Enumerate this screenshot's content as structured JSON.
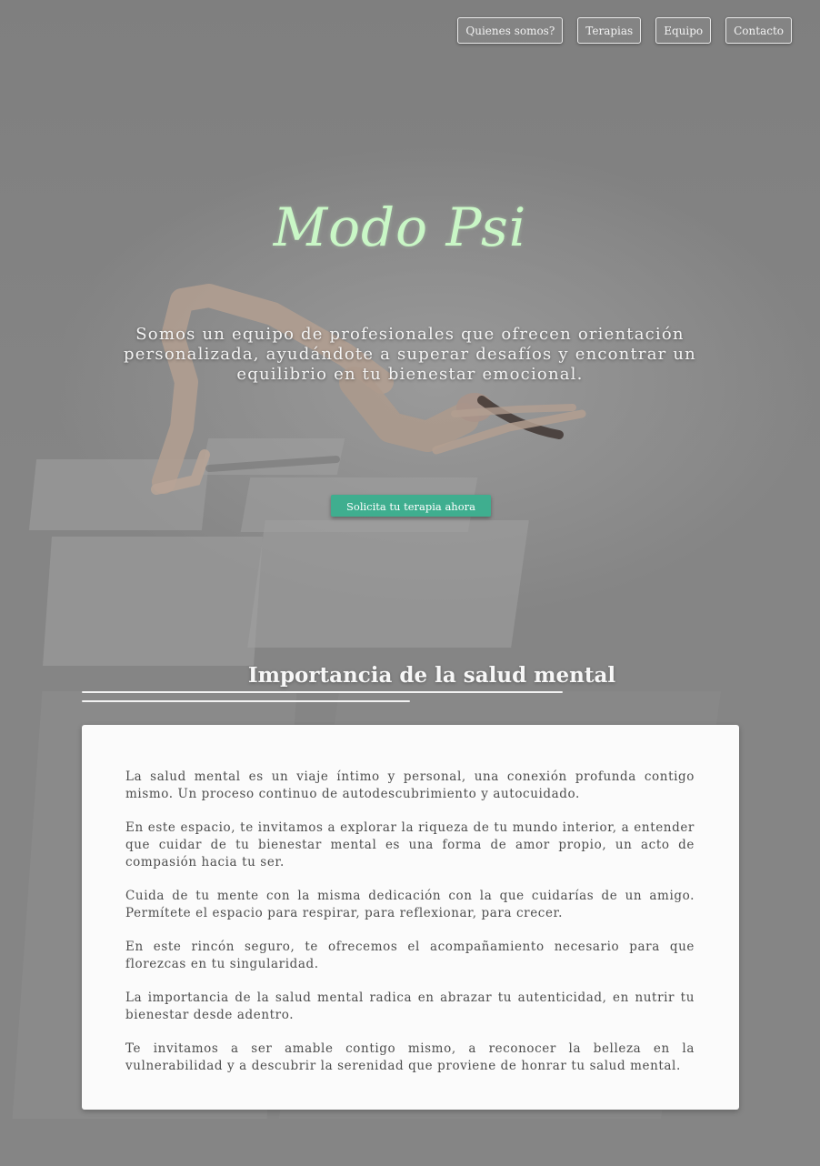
{
  "nav": {
    "items": [
      {
        "label": "Quienes somos?"
      },
      {
        "label": "Terapias"
      },
      {
        "label": "Equipo"
      },
      {
        "label": "Contacto"
      }
    ]
  },
  "hero": {
    "logo_text": "Modo Psi",
    "tagline": "Somos un equipo de profesionales que ofrecen orientación personalizada, ayudándote a superar desafíos y encontrar un equilibrio en tu bienestar emocional.",
    "cta_label": "Solicita tu terapia ahora"
  },
  "section": {
    "title": "Importancia de la salud mental",
    "paragraphs": [
      "La salud mental es un viaje íntimo y personal, una conexión profunda contigo mismo. Un proceso continuo de autodescubrimiento y autocuidado.",
      "En este espacio, te invitamos a explorar la riqueza de tu mundo interior, a entender que cuidar de tu bienestar mental es una forma de amor propio, un acto de compasión hacia tu ser.",
      "Cuida de tu mente con la misma dedicación con la que cuidarías de un amigo. Permítete el espacio para respirar, para reflexionar, para crecer.",
      "En este rincón seguro, te ofrecemos el acompañamiento necesario para que florezcas en tu singularidad.",
      "La importancia de la salud mental radica en abrazar tu autenticidad, en nutrir tu bienestar desde adentro.",
      "Te invitamos a ser amable contigo mismo, a reconocer la belleza en la vulnerabilidad y a descubrir la serenidad que proviene de honrar tu salud mental."
    ]
  },
  "colors": {
    "accent": "#3fae8f",
    "logo": "#c9f7c6"
  }
}
